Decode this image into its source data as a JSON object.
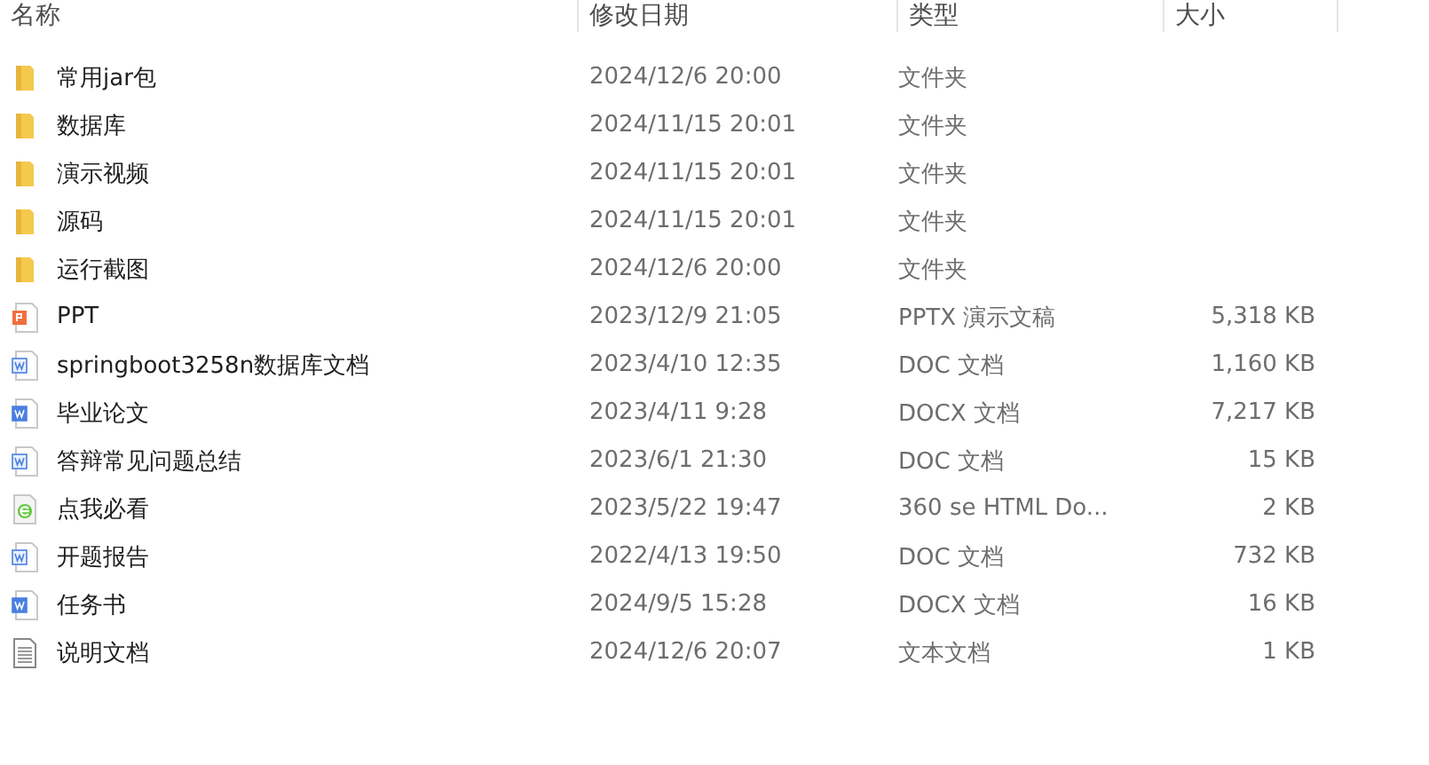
{
  "columns": [
    "名称",
    "修改日期",
    "类型",
    "大小"
  ],
  "files": [
    {
      "kind": "folder",
      "name": "常用jar包",
      "date": "2024/12/6 20:00",
      "type": "文件夹"
    },
    {
      "kind": "folder",
      "name": "数据库",
      "date": "2024/11/15 20:01",
      "type": "文件夹"
    },
    {
      "kind": "folder",
      "name": "演示视频",
      "date": "2024/11/15 20:01",
      "type": "文件夹"
    },
    {
      "kind": "folder",
      "name": "源码",
      "date": "2024/11/15 20:01",
      "type": "文件夹"
    },
    {
      "kind": "folder",
      "name": "运行截图",
      "date": "2024/12/6 20:00",
      "type": "文件夹"
    },
    {
      "kind": "ppt",
      "name": "PPT",
      "date": "2023/12/9 21:05",
      "type": "PPTX 演示文稿",
      "size": "5,318 KB"
    },
    {
      "kind": "doc",
      "name": "springboot3258n数据库文档",
      "date": "2023/4/10 12:35",
      "type": "DOC 文档",
      "size": "1,160 KB"
    },
    {
      "kind": "docx",
      "name": "毕业论文",
      "date": "2023/4/11 9:28",
      "type": "DOCX 文档",
      "size": "7,217 KB"
    },
    {
      "kind": "doc",
      "name": "答辩常见问题总结",
      "date": "2023/6/1 21:30",
      "type": "DOC 文档",
      "size": "15 KB"
    },
    {
      "kind": "html",
      "name": "点我必看",
      "date": "2023/5/22 19:47",
      "type": "360 se HTML Do...",
      "size": "2 KB"
    },
    {
      "kind": "doc",
      "name": "开题报告",
      "date": "2022/4/13 19:50",
      "type": "DOC 文档",
      "size": "732 KB"
    },
    {
      "kind": "docx",
      "name": "任务书",
      "date": "2024/9/5 15:28",
      "type": "DOCX 文档",
      "size": "16 KB"
    },
    {
      "kind": "txt",
      "name": "说明文档",
      "date": "2024/12/6 20:07",
      "type": "文本文档",
      "size": "1 KB"
    }
  ]
}
